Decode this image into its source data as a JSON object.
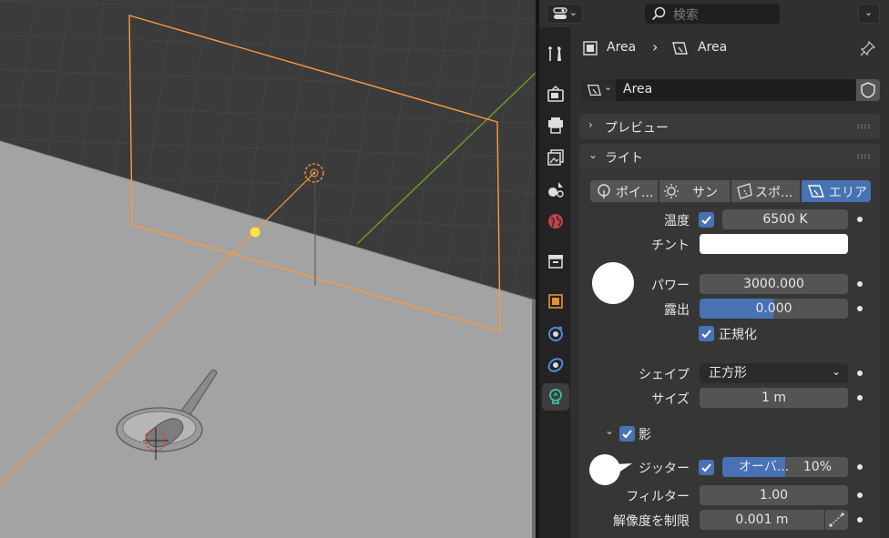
{
  "header": {
    "search_placeholder": "検索"
  },
  "breadcrumb": {
    "object_name": "Area",
    "data_name": "Area"
  },
  "datablock": {
    "name": "Area"
  },
  "panels": {
    "preview_title": "プレビュー",
    "light_title": "ライト",
    "shadow_title": "影"
  },
  "light_types": [
    {
      "label": "ポイ...",
      "icon": "point-light-icon",
      "active": false
    },
    {
      "label": "サン",
      "icon": "sun-light-icon",
      "active": false
    },
    {
      "label": "スポ...",
      "icon": "spot-light-icon",
      "active": false
    },
    {
      "label": "エリア",
      "icon": "area-light-icon",
      "active": true
    }
  ],
  "properties": {
    "temperature_label": "温度",
    "temperature_checked": true,
    "temperature_value": "6500 K",
    "tint_label": "チント",
    "tint_color": "#ffffff",
    "power_label": "パワー",
    "power_value": "3000.000",
    "exposure_label": "露出",
    "exposure_value": "0.000",
    "exposure_fill": 0.5,
    "normalize_label": "正規化",
    "normalize_checked": true,
    "shape_label": "シェイプ",
    "shape_value": "正方形",
    "size_label": "サイズ",
    "size_value": "1 m"
  },
  "shadow": {
    "enabled": true,
    "jitter_label": "ジッター",
    "jitter_checked": true,
    "overblur_label": "オーバ...",
    "overblur_value": "10%",
    "overblur_fill": 0.5,
    "filter_label": "フィルター",
    "filter_value": "1.00",
    "resolution_limit_label": "解像度を制限",
    "resolution_limit_value": "0.001 m"
  },
  "colors": {
    "accent": "#4772b3",
    "selection_outline": "#ff9a3c",
    "light_center": "#ffe43c",
    "y_axis": "#6a9a23"
  },
  "tabs": [
    {
      "icon": "tool-icon"
    },
    {
      "icon": "render-icon"
    },
    {
      "icon": "output-icon"
    },
    {
      "icon": "view-layer-icon"
    },
    {
      "icon": "scene-icon"
    },
    {
      "icon": "world-icon"
    },
    {
      "icon": "collection-icon"
    },
    {
      "icon": "object-icon"
    },
    {
      "icon": "physics-icon"
    },
    {
      "icon": "constraints-icon"
    },
    {
      "icon": "light-data-icon"
    }
  ]
}
